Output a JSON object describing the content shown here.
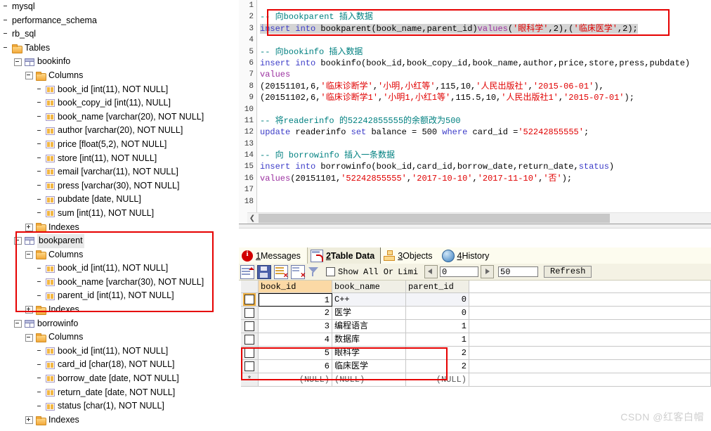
{
  "tree": {
    "nodes": [
      {
        "indent": 0,
        "expander": "none",
        "icon": "none",
        "label": "mysql",
        "selected": false
      },
      {
        "indent": 0,
        "expander": "none",
        "icon": "none",
        "label": "performance_schema",
        "selected": false
      },
      {
        "indent": 0,
        "expander": "none",
        "icon": "none",
        "label": "rb_sql",
        "selected": false
      },
      {
        "indent": 0,
        "expander": "none",
        "icon": "folder",
        "label": "Tables",
        "selected": false
      },
      {
        "indent": 1,
        "expander": "minus",
        "icon": "table",
        "label": "bookinfo",
        "selected": false
      },
      {
        "indent": 2,
        "expander": "minus",
        "icon": "folder",
        "label": "Columns",
        "selected": false
      },
      {
        "indent": 3,
        "expander": "none",
        "icon": "column",
        "label": "book_id [int(11), NOT NULL]",
        "selected": false
      },
      {
        "indent": 3,
        "expander": "none",
        "icon": "column",
        "label": "book_copy_id [int(11), NULL]",
        "selected": false
      },
      {
        "indent": 3,
        "expander": "none",
        "icon": "column",
        "label": "book_name [varchar(20), NOT NULL]",
        "selected": false
      },
      {
        "indent": 3,
        "expander": "none",
        "icon": "column",
        "label": "author [varchar(20), NOT NULL]",
        "selected": false
      },
      {
        "indent": 3,
        "expander": "none",
        "icon": "column",
        "label": "price [float(5,2), NOT NULL]",
        "selected": false
      },
      {
        "indent": 3,
        "expander": "none",
        "icon": "column",
        "label": "store [int(11), NOT NULL]",
        "selected": false
      },
      {
        "indent": 3,
        "expander": "none",
        "icon": "column",
        "label": "email [varchar(11), NOT NULL]",
        "selected": false
      },
      {
        "indent": 3,
        "expander": "none",
        "icon": "column",
        "label": "press [varchar(30), NOT NULL]",
        "selected": false
      },
      {
        "indent": 3,
        "expander": "none",
        "icon": "column",
        "label": "pubdate [date, NULL]",
        "selected": false
      },
      {
        "indent": 3,
        "expander": "none",
        "icon": "column",
        "label": "sum [int(11), NOT NULL]",
        "selected": false
      },
      {
        "indent": 2,
        "expander": "plus",
        "icon": "folder",
        "label": "Indexes",
        "selected": false
      },
      {
        "indent": 1,
        "expander": "minus",
        "icon": "table",
        "label": "bookparent",
        "selected": true
      },
      {
        "indent": 2,
        "expander": "minus",
        "icon": "folder",
        "label": "Columns",
        "selected": false
      },
      {
        "indent": 3,
        "expander": "none",
        "icon": "column",
        "label": "book_id [int(11), NOT NULL]",
        "selected": false
      },
      {
        "indent": 3,
        "expander": "none",
        "icon": "column",
        "label": "book_name [varchar(30), NOT NULL]",
        "selected": false
      },
      {
        "indent": 3,
        "expander": "none",
        "icon": "column",
        "label": "parent_id [int(11), NOT NULL]",
        "selected": false
      },
      {
        "indent": 2,
        "expander": "plus",
        "icon": "folder",
        "label": "Indexes",
        "selected": false
      },
      {
        "indent": 1,
        "expander": "minus",
        "icon": "table",
        "label": "borrowinfo",
        "selected": false
      },
      {
        "indent": 2,
        "expander": "minus",
        "icon": "folder",
        "label": "Columns",
        "selected": false
      },
      {
        "indent": 3,
        "expander": "none",
        "icon": "column",
        "label": "book_id [int(11), NOT NULL]",
        "selected": false
      },
      {
        "indent": 3,
        "expander": "none",
        "icon": "column",
        "label": "card_id [char(18), NOT NULL]",
        "selected": false
      },
      {
        "indent": 3,
        "expander": "none",
        "icon": "column",
        "label": "borrow_date [date, NOT NULL]",
        "selected": false
      },
      {
        "indent": 3,
        "expander": "none",
        "icon": "column",
        "label": "return_date [date, NOT NULL]",
        "selected": false
      },
      {
        "indent": 3,
        "expander": "none",
        "icon": "column",
        "label": "status [char(1), NOT NULL]",
        "selected": false
      },
      {
        "indent": 2,
        "expander": "plus",
        "icon": "folder",
        "label": "Indexes",
        "selected": false
      }
    ]
  },
  "editor": {
    "line_numbers": [
      "1",
      "2",
      "3",
      "4",
      "5",
      "6",
      "7",
      "8",
      "9",
      "10",
      "11",
      "12",
      "13",
      "14",
      "15",
      "16",
      "17",
      "18"
    ],
    "lines": [
      [],
      [
        {
          "t": "-- 向bookparent 插入数据",
          "c": "com"
        }
      ],
      [
        {
          "t": "insert into",
          "c": "kw",
          "sel": true
        },
        {
          "t": " ",
          "c": "id",
          "sel": true
        },
        {
          "t": "bookparent",
          "c": "id",
          "sel": true
        },
        {
          "t": "(",
          "c": "id",
          "sel": true
        },
        {
          "t": "book_name,parent_id",
          "c": "id",
          "sel": true
        },
        {
          "t": ")",
          "c": "id",
          "sel": true
        },
        {
          "t": "values",
          "c": "kw2",
          "sel": true
        },
        {
          "t": "(",
          "c": "id",
          "sel": true
        },
        {
          "t": "'眼科学'",
          "c": "str",
          "sel": true
        },
        {
          "t": ",2),(",
          "c": "id",
          "sel": true
        },
        {
          "t": "'临床医学'",
          "c": "str",
          "sel": true
        },
        {
          "t": ",2);",
          "c": "id",
          "sel": true
        }
      ],
      [],
      [
        {
          "t": "-- 向bookinfo 插入数据",
          "c": "com"
        }
      ],
      [
        {
          "t": "insert into",
          "c": "kw"
        },
        {
          "t": " bookinfo(book_id,book_copy_id,book_name,author,price,store,press,pubdate)",
          "c": "id"
        }
      ],
      [
        {
          "t": "values",
          "c": "kw2"
        }
      ],
      [
        {
          "t": "(20151101,6,",
          "c": "id"
        },
        {
          "t": "'临床诊断学'",
          "c": "str"
        },
        {
          "t": ",",
          "c": "id"
        },
        {
          "t": "'小明,小红等'",
          "c": "str"
        },
        {
          "t": ",115,10,",
          "c": "id"
        },
        {
          "t": "'人民出版社'",
          "c": "str"
        },
        {
          "t": ",",
          "c": "id"
        },
        {
          "t": "'2015-06-01'",
          "c": "str"
        },
        {
          "t": "),",
          "c": "id"
        }
      ],
      [
        {
          "t": "(20151102,6,",
          "c": "id"
        },
        {
          "t": "'临床诊断学1'",
          "c": "str"
        },
        {
          "t": ",",
          "c": "id"
        },
        {
          "t": "'小明1,小红1等'",
          "c": "str"
        },
        {
          "t": ",115.5,10,",
          "c": "id"
        },
        {
          "t": "'人民出版社1'",
          "c": "str"
        },
        {
          "t": ",",
          "c": "id"
        },
        {
          "t": "'2015-07-01'",
          "c": "str"
        },
        {
          "t": ");",
          "c": "id"
        }
      ],
      [],
      [
        {
          "t": "-- 将readerinfo 的52242855555的余额改为500",
          "c": "com"
        }
      ],
      [
        {
          "t": "update",
          "c": "kw"
        },
        {
          "t": " readerinfo ",
          "c": "id"
        },
        {
          "t": "set",
          "c": "kw"
        },
        {
          "t": " balance = 500 ",
          "c": "id"
        },
        {
          "t": "where",
          "c": "kw"
        },
        {
          "t": " card_id =",
          "c": "id"
        },
        {
          "t": "'52242855555'",
          "c": "str"
        },
        {
          "t": ";",
          "c": "id"
        }
      ],
      [],
      [
        {
          "t": "-- 向 borrowinfo 插入一条数据",
          "c": "com"
        }
      ],
      [
        {
          "t": "insert into",
          "c": "kw"
        },
        {
          "t": " borrowinfo(book_id,card_id,borrow_date,return_date,",
          "c": "id"
        },
        {
          "t": "status",
          "c": "kw"
        },
        {
          "t": ")",
          "c": "id"
        }
      ],
      [
        {
          "t": "values",
          "c": "kw2"
        },
        {
          "t": "(20151101,",
          "c": "id"
        },
        {
          "t": "'52242855555'",
          "c": "str"
        },
        {
          "t": ",",
          "c": "id"
        },
        {
          "t": "'2017-10-10'",
          "c": "str"
        },
        {
          "t": ",",
          "c": "id"
        },
        {
          "t": "'2017-11-10'",
          "c": "str"
        },
        {
          "t": ",",
          "c": "id"
        },
        {
          "t": "'否'",
          "c": "str"
        },
        {
          "t": ");",
          "c": "id"
        }
      ],
      [],
      []
    ]
  },
  "results": {
    "tabs": [
      {
        "num": "1",
        "label": "Messages",
        "icon": "info-icon",
        "active": false
      },
      {
        "num": "2",
        "label": "Table Data",
        "icon": "table-data-icon",
        "active": true
      },
      {
        "num": "3",
        "label": "Objects",
        "icon": "objects-icon",
        "active": false
      },
      {
        "num": "4",
        "label": "History",
        "icon": "history-icon",
        "active": false
      }
    ],
    "toolbar": {
      "show_all_label": "Show All Or",
      "limit_label": "Limi",
      "offset_value": "0",
      "limit_value": "50",
      "refresh_label": "Refresh",
      "show_all_checked": false
    },
    "grid": {
      "columns": [
        "book_id",
        "book_name",
        "parent_id"
      ],
      "highlighted_column": "book_id",
      "rows": [
        {
          "book_id": "1",
          "book_name": "C++",
          "parent_id": "0",
          "current": true
        },
        {
          "book_id": "2",
          "book_name": "医学",
          "parent_id": "0",
          "current": false
        },
        {
          "book_id": "3",
          "book_name": "编程语言",
          "parent_id": "1",
          "current": false
        },
        {
          "book_id": "4",
          "book_name": "数据库",
          "parent_id": "1",
          "current": false
        },
        {
          "book_id": "5",
          "book_name": "眼科学",
          "parent_id": "2",
          "current": false
        },
        {
          "book_id": "6",
          "book_name": "临床医学",
          "parent_id": "2",
          "current": false
        }
      ],
      "new_row": {
        "book_id": "(NULL)",
        "book_name": "(NULL)",
        "parent_id": "(NULL)"
      }
    }
  },
  "watermark": "CSDN @红客白帽",
  "colors": {
    "highlight_box": "#e60000",
    "comment": "#008080",
    "keyword": "#3b3bc8",
    "keyword_alt": "#9b30a0",
    "string": "#e00000",
    "header_highlight": "#fbd9a5"
  }
}
